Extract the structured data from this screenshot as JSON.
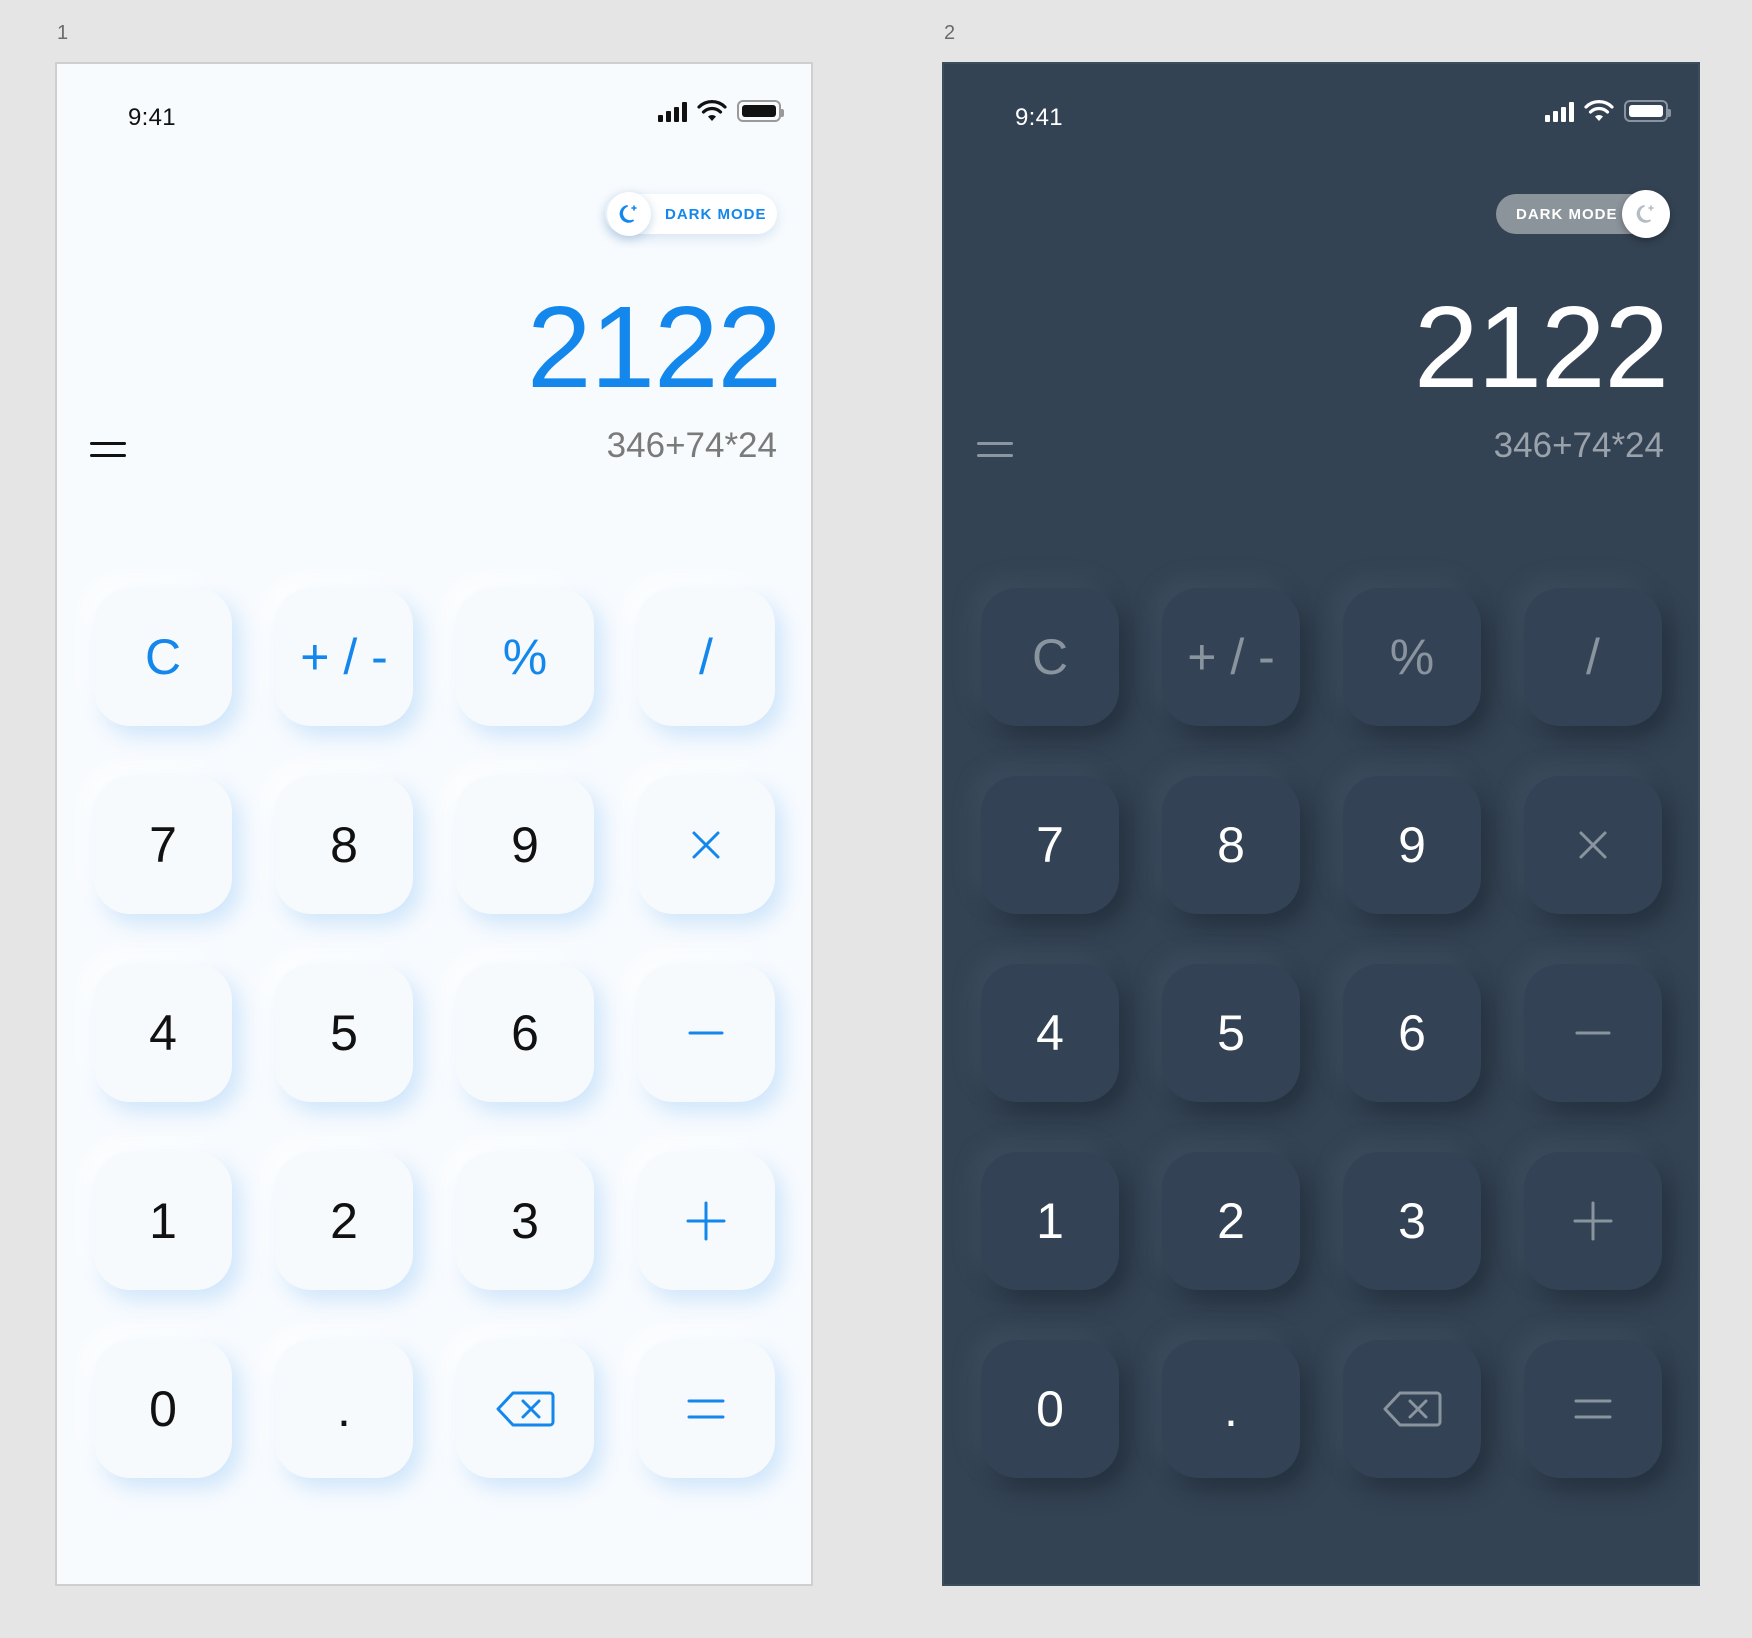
{
  "frames": [
    {
      "label": "1",
      "theme": "light",
      "status": {
        "time": "9:41"
      },
      "toggle": {
        "label": "DARK MODE",
        "on": false
      },
      "display": {
        "result": "2122",
        "expression": "346+74*24"
      },
      "keys": [
        {
          "label": "C",
          "name": "clear",
          "accent": true
        },
        {
          "label": "+ / -",
          "name": "plus-minus",
          "accent": true
        },
        {
          "label": "%",
          "name": "percent",
          "accent": true
        },
        {
          "label": "/",
          "name": "divide",
          "accent": true
        },
        {
          "label": "7",
          "name": "digit-7",
          "accent": false
        },
        {
          "label": "8",
          "name": "digit-8",
          "accent": false
        },
        {
          "label": "9",
          "name": "digit-9",
          "accent": false
        },
        {
          "icon": "multiply-icon",
          "name": "multiply",
          "accent": true
        },
        {
          "label": "4",
          "name": "digit-4",
          "accent": false
        },
        {
          "label": "5",
          "name": "digit-5",
          "accent": false
        },
        {
          "label": "6",
          "name": "digit-6",
          "accent": false
        },
        {
          "icon": "minus-icon",
          "name": "subtract",
          "accent": true
        },
        {
          "label": "1",
          "name": "digit-1",
          "accent": false
        },
        {
          "label": "2",
          "name": "digit-2",
          "accent": false
        },
        {
          "label": "3",
          "name": "digit-3",
          "accent": false
        },
        {
          "icon": "plus-icon",
          "name": "add",
          "accent": true
        },
        {
          "label": "0",
          "name": "digit-0",
          "accent": false
        },
        {
          "label": ".",
          "name": "decimal",
          "accent": false
        },
        {
          "icon": "backspace-icon",
          "name": "backspace",
          "accent": true
        },
        {
          "icon": "equals-icon",
          "name": "equals",
          "accent": true
        }
      ]
    },
    {
      "label": "2",
      "theme": "dark",
      "status": {
        "time": "9:41"
      },
      "toggle": {
        "label": "DARK MODE",
        "on": true
      },
      "display": {
        "result": "2122",
        "expression": "346+74*24"
      },
      "keys": [
        {
          "label": "C",
          "name": "clear",
          "accent": true
        },
        {
          "label": "+ / -",
          "name": "plus-minus",
          "accent": true
        },
        {
          "label": "%",
          "name": "percent",
          "accent": true
        },
        {
          "label": "/",
          "name": "divide",
          "accent": true
        },
        {
          "label": "7",
          "name": "digit-7",
          "accent": false
        },
        {
          "label": "8",
          "name": "digit-8",
          "accent": false
        },
        {
          "label": "9",
          "name": "digit-9",
          "accent": false
        },
        {
          "icon": "multiply-icon",
          "name": "multiply",
          "accent": true
        },
        {
          "label": "4",
          "name": "digit-4",
          "accent": false
        },
        {
          "label": "5",
          "name": "digit-5",
          "accent": false
        },
        {
          "label": "6",
          "name": "digit-6",
          "accent": false
        },
        {
          "icon": "minus-icon",
          "name": "subtract",
          "accent": true
        },
        {
          "label": "1",
          "name": "digit-1",
          "accent": false
        },
        {
          "label": "2",
          "name": "digit-2",
          "accent": false
        },
        {
          "label": "3",
          "name": "digit-3",
          "accent": false
        },
        {
          "icon": "plus-icon",
          "name": "add",
          "accent": true
        },
        {
          "label": "0",
          "name": "digit-0",
          "accent": false
        },
        {
          "label": ".",
          "name": "decimal",
          "accent": false
        },
        {
          "icon": "backspace-icon",
          "name": "backspace",
          "accent": true
        },
        {
          "icon": "equals-icon",
          "name": "equals",
          "accent": true
        }
      ]
    }
  ],
  "colors": {
    "accent_light": "#1387ec",
    "accent_dark": "#8a949e",
    "bg_light": "#f8fbfe",
    "bg_dark": "#344354",
    "canvas": "#e5e5e5"
  }
}
